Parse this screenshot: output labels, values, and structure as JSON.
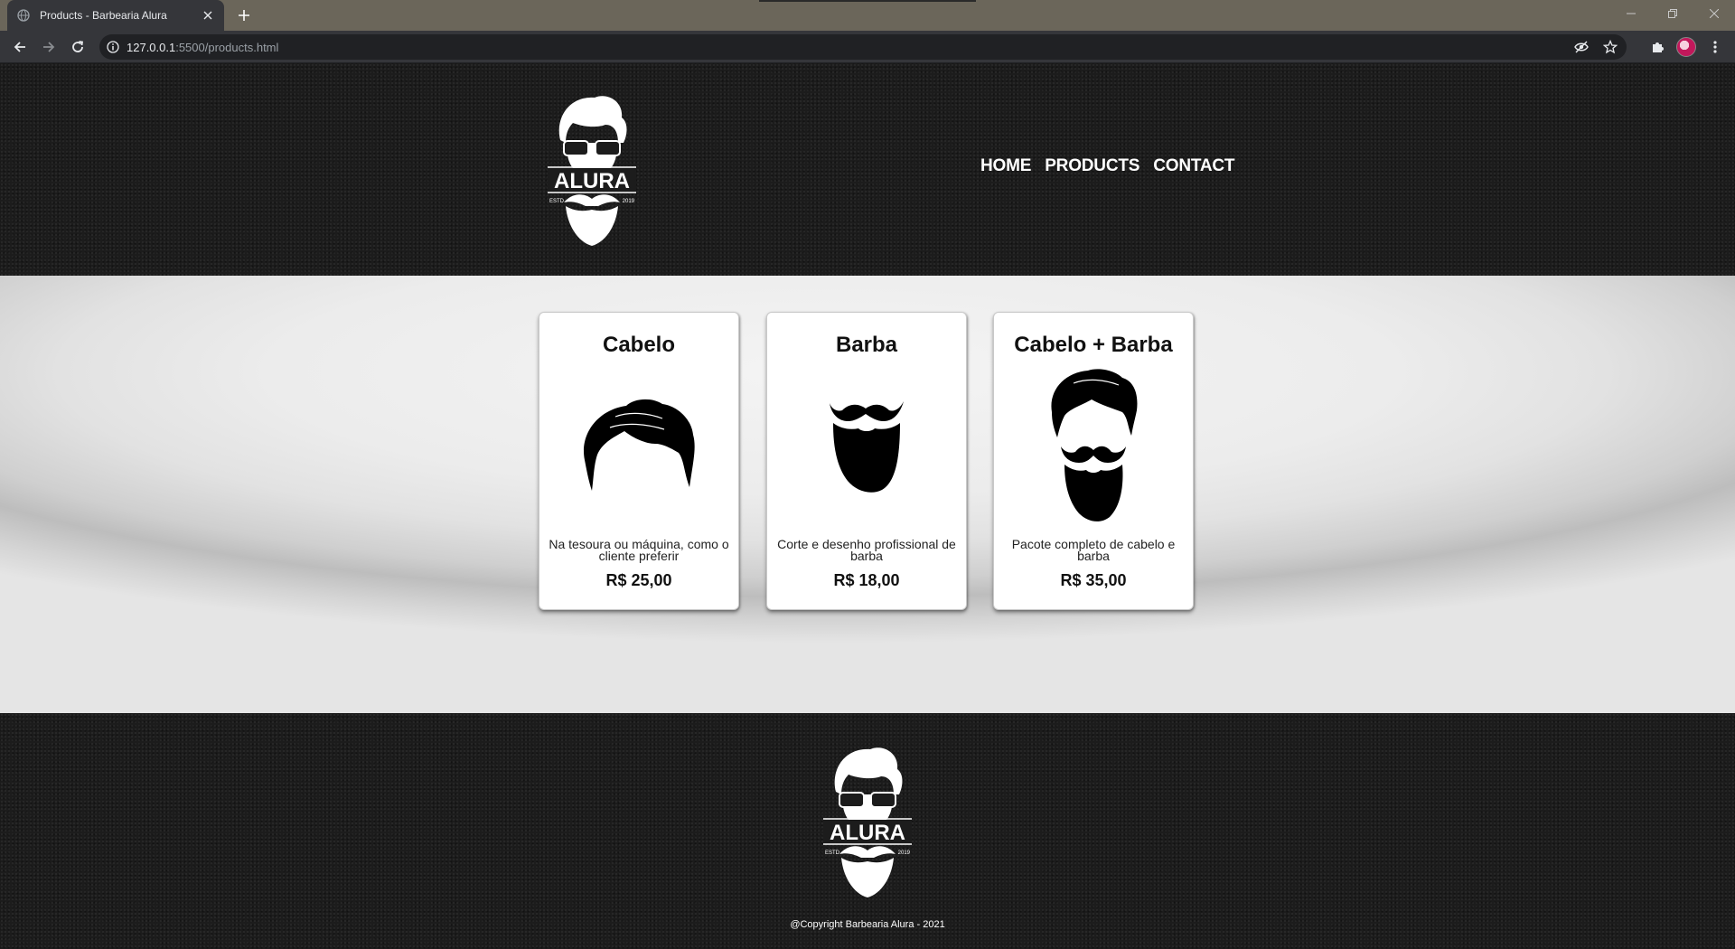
{
  "browser": {
    "tab_title": "Products - Barbearia Alura",
    "url_host": "127.0.0.1",
    "url_rest": ":5500/products.html",
    "icons": [
      "globe-icon",
      "close-icon",
      "plus-icon",
      "back-icon",
      "forward-icon",
      "reload-icon",
      "info-icon",
      "eye-off-icon",
      "star-icon",
      "puzzle-icon",
      "menu-icon"
    ]
  },
  "header": {
    "logo": {
      "brand": "ALURA",
      "left": "ESTD",
      "right": "2019"
    },
    "nav": [
      {
        "label": "HOME"
      },
      {
        "label": "PRODUCTS"
      },
      {
        "label": "CONTACT"
      }
    ]
  },
  "products": [
    {
      "title": "Cabelo",
      "description": "Na tesoura ou máquina, como o cliente preferir",
      "price": "R$ 25,00",
      "icon": "hair-icon"
    },
    {
      "title": "Barba",
      "description": "Corte e desenho profissional de barba",
      "price": "R$ 18,00",
      "icon": "beard-icon"
    },
    {
      "title": "Cabelo + Barba",
      "description": "Pacote completo de cabelo e barba",
      "price": "R$ 35,00",
      "icon": "hair-and-beard-icon"
    }
  ],
  "footer": {
    "logo": {
      "brand": "ALURA",
      "left": "ESTD",
      "right": "2019"
    },
    "copyright": "@Copyright Barbearia Alura - 2021"
  },
  "colors": {
    "header_bg": "#1c1c1c",
    "chrome_frame": "#6b665a",
    "chrome_toolbar": "#35363a"
  }
}
